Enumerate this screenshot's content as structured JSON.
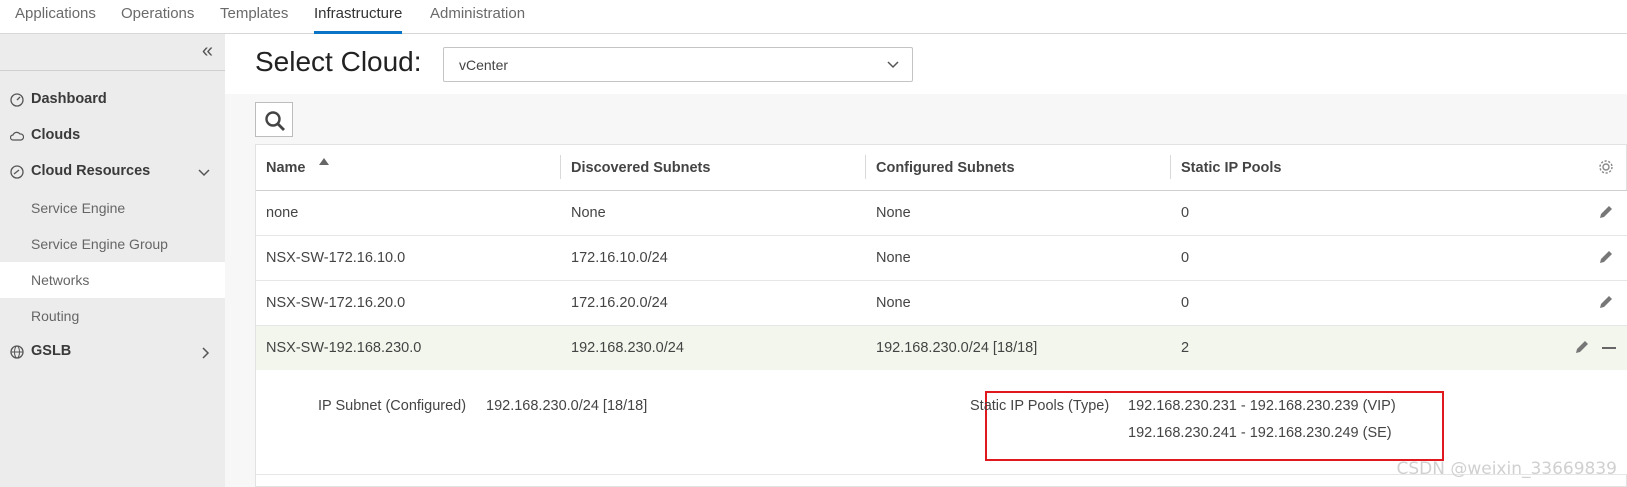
{
  "topnav": {
    "tabs": [
      {
        "label": "Applications"
      },
      {
        "label": "Operations"
      },
      {
        "label": "Templates"
      },
      {
        "label": "Infrastructure"
      },
      {
        "label": "Administration"
      }
    ],
    "active": "Infrastructure"
  },
  "sidebar": {
    "collapse_icon": "«",
    "items": [
      {
        "label": "Dashboard",
        "icon": "dashboard-icon"
      },
      {
        "label": "Clouds",
        "icon": "cloud-icon"
      },
      {
        "label": "Cloud Resources",
        "icon": "gauge-icon",
        "expanded": true
      },
      {
        "label": "GSLB",
        "icon": "globe-icon",
        "expanded": false
      }
    ],
    "subitems": [
      {
        "label": "Service Engine"
      },
      {
        "label": "Service Engine Group"
      },
      {
        "label": "Networks",
        "active": true
      },
      {
        "label": "Routing"
      }
    ]
  },
  "main": {
    "title": "Select Cloud:",
    "cloud_select": "vCenter",
    "table": {
      "columns": [
        "Name",
        "Discovered Subnets",
        "Configured Subnets",
        "Static IP Pools"
      ],
      "rows": [
        {
          "name": "none",
          "discovered": "None",
          "configured": "None",
          "pools": "0"
        },
        {
          "name": "NSX-SW-172.16.10.0",
          "discovered": "172.16.10.0/24",
          "configured": "None",
          "pools": "0"
        },
        {
          "name": "NSX-SW-172.16.20.0",
          "discovered": "172.16.20.0/24",
          "configured": "None",
          "pools": "0"
        },
        {
          "name": "NSX-SW-192.168.230.0",
          "discovered": "192.168.230.0/24",
          "configured": "192.168.230.0/24 [18/18]",
          "pools": "2"
        }
      ],
      "detail": {
        "subnet_label": "IP Subnet (Configured)",
        "subnet_value": "192.168.230.0/24 [18/18]",
        "pools_label": "Static IP Pools (Type)",
        "pool_1": "192.168.230.231 - 192.168.230.239 (VIP)",
        "pool_2": "192.168.230.241 - 192.168.230.249 (SE)"
      }
    }
  },
  "watermark": "CSDN @weixin_33669839",
  "colors": {
    "accent": "#0b74c4",
    "highlight_box": "#e0191e",
    "selected_row": "#f2f6ec"
  }
}
